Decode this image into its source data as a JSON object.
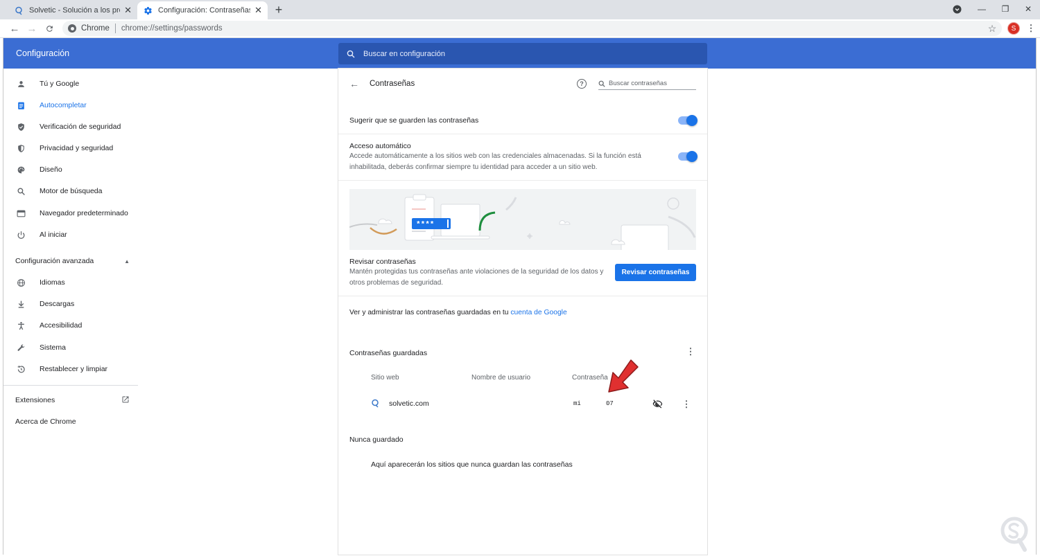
{
  "browser": {
    "tabs": [
      {
        "label": "Solvetic - Solución a los problem"
      },
      {
        "label": "Configuración: Contraseñas"
      }
    ],
    "omnibox_site": "Chrome",
    "omnibox_url": "chrome://settings/passwords",
    "profile_initial": "S"
  },
  "header": {
    "title": "Configuración",
    "search_placeholder": "Buscar en configuración"
  },
  "sidebar": {
    "items": [
      {
        "label": "Tú y Google",
        "icon": "person-icon"
      },
      {
        "label": "Autocompletar",
        "icon": "clipboard-icon"
      },
      {
        "label": "Verificación de seguridad",
        "icon": "shield-check-icon"
      },
      {
        "label": "Privacidad y seguridad",
        "icon": "shield-icon"
      },
      {
        "label": "Diseño",
        "icon": "palette-icon"
      },
      {
        "label": "Motor de búsqueda",
        "icon": "search-icon"
      },
      {
        "label": "Navegador predeterminado",
        "icon": "browser-icon"
      },
      {
        "label": "Al iniciar",
        "icon": "power-icon"
      }
    ],
    "advanced_label": "Configuración avanzada",
    "advanced_items": [
      {
        "label": "Idiomas",
        "icon": "globe-icon"
      },
      {
        "label": "Descargas",
        "icon": "download-icon"
      },
      {
        "label": "Accesibilidad",
        "icon": "accessibility-icon"
      },
      {
        "label": "Sistema",
        "icon": "wrench-icon"
      },
      {
        "label": "Restablecer y limpiar",
        "icon": "restore-icon"
      }
    ],
    "extensions_label": "Extensiones",
    "about_label": "Acerca de Chrome"
  },
  "passwords": {
    "title": "Contraseñas",
    "search_placeholder": "Buscar contraseñas",
    "offer_save_label": "Sugerir que se guarden las contraseñas",
    "offer_save_on": true,
    "auto_signin_label": "Acceso automático",
    "auto_signin_desc1": "Accede automáticamente a los sitios web con las credenciales almacenadas. Si la función está",
    "auto_signin_desc2": "inhabilitada, deberás confirmar siempre tu identidad para acceder a un sitio web.",
    "auto_signin_on": true,
    "illustration_mask": "****",
    "check_title": "Revisar contraseñas",
    "check_desc1": "Mantén protegidas tus contraseñas ante violaciones de la seguridad de los datos y",
    "check_desc2": "otros problemas de seguridad.",
    "check_button": "Revisar contraseñas",
    "manage_text": "Ver y administrar las contraseñas guardadas en tu ",
    "manage_link": "cuenta de Google",
    "saved_title": "Contraseñas guardadas",
    "columns": [
      "Sitio web",
      "Nombre de usuario",
      "Contraseña"
    ],
    "entries": [
      {
        "site": "solvetic.com",
        "username": "",
        "password_start": "mi",
        "password_end": "07"
      }
    ],
    "never_saved_title": "Nunca guardado",
    "never_saved_text": "Aquí aparecerán los sitios que nunca guardan las contraseñas"
  },
  "colors": {
    "header_blue": "#3b6dd3",
    "accent": "#1a73e8",
    "annotation_arrow": "#e03030"
  }
}
